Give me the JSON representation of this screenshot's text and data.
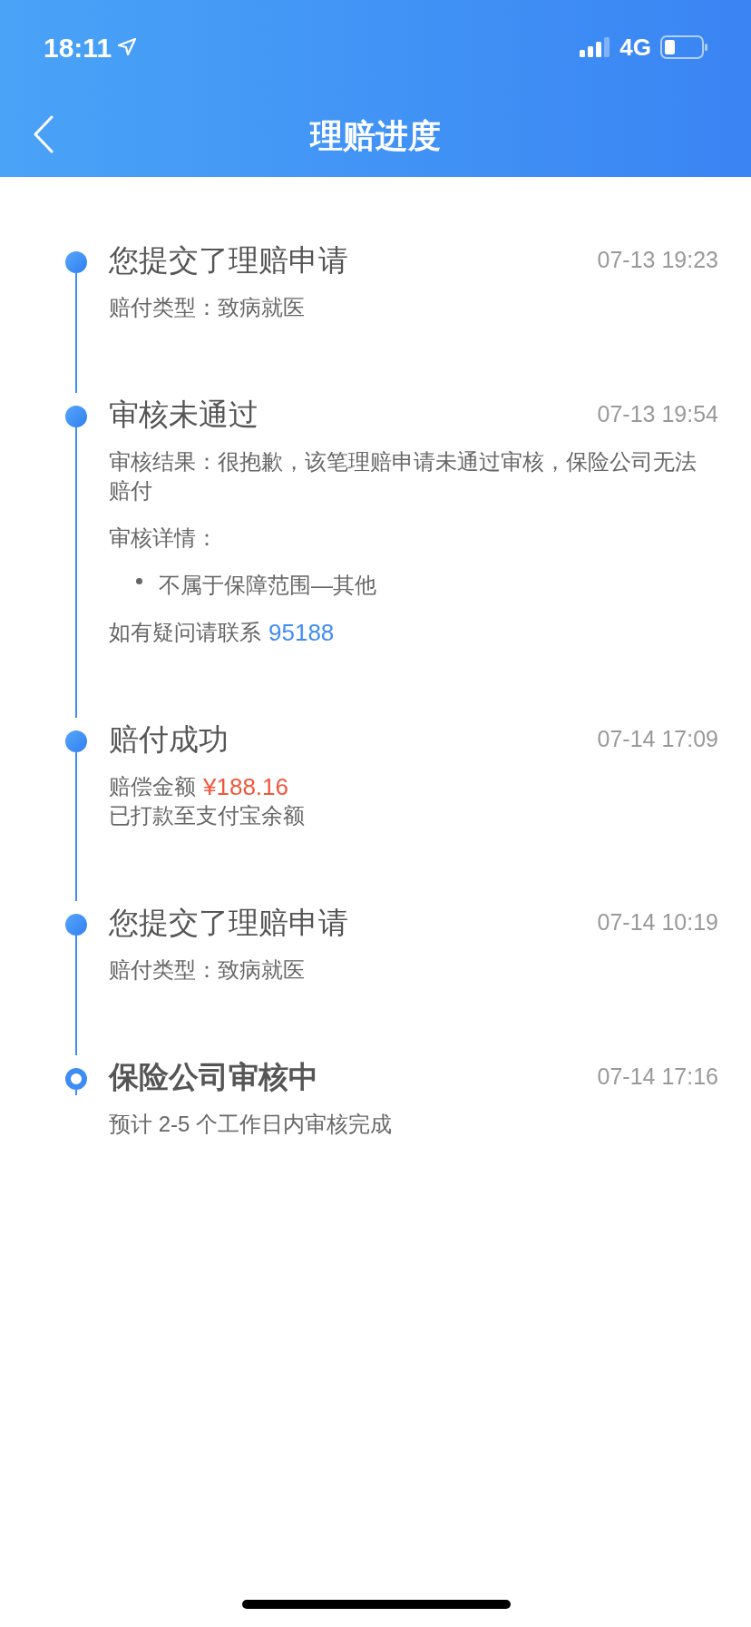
{
  "status_bar": {
    "time": "18:11",
    "network": "4G"
  },
  "nav": {
    "title": "理赔进度"
  },
  "events": [
    {
      "title": "您提交了理赔申请",
      "time": "07-13 19:23",
      "current": false,
      "lines": [
        {
          "kind": "text",
          "text": "赔付类型：致病就医"
        }
      ]
    },
    {
      "title": "审核未通过",
      "time": "07-13 19:54",
      "current": false,
      "lines": [
        {
          "kind": "text",
          "text": "审核结果：很抱歉，该笔理赔申请未通过审核，保险公司无法赔付"
        },
        {
          "kind": "text",
          "text": "审核详情："
        },
        {
          "kind": "bullet",
          "text": "不属于保障范围—其他"
        },
        {
          "kind": "contact",
          "text": "如有疑问请联系",
          "link": "95188"
        }
      ]
    },
    {
      "title": "赔付成功",
      "time": "07-14 17:09",
      "current": false,
      "lines": [
        {
          "kind": "amount",
          "text": "赔偿金额",
          "value": "¥188.16"
        },
        {
          "kind": "text",
          "text": "已打款至支付宝余额"
        }
      ]
    },
    {
      "title": "您提交了理赔申请",
      "time": "07-14 10:19",
      "current": false,
      "lines": [
        {
          "kind": "text",
          "text": "赔付类型：致病就医"
        }
      ]
    },
    {
      "title": "保险公司审核中",
      "time": "07-14 17:16",
      "current": true,
      "lines": [
        {
          "kind": "text",
          "text": "预计 2-5 个工作日内审核完成"
        }
      ]
    }
  ]
}
